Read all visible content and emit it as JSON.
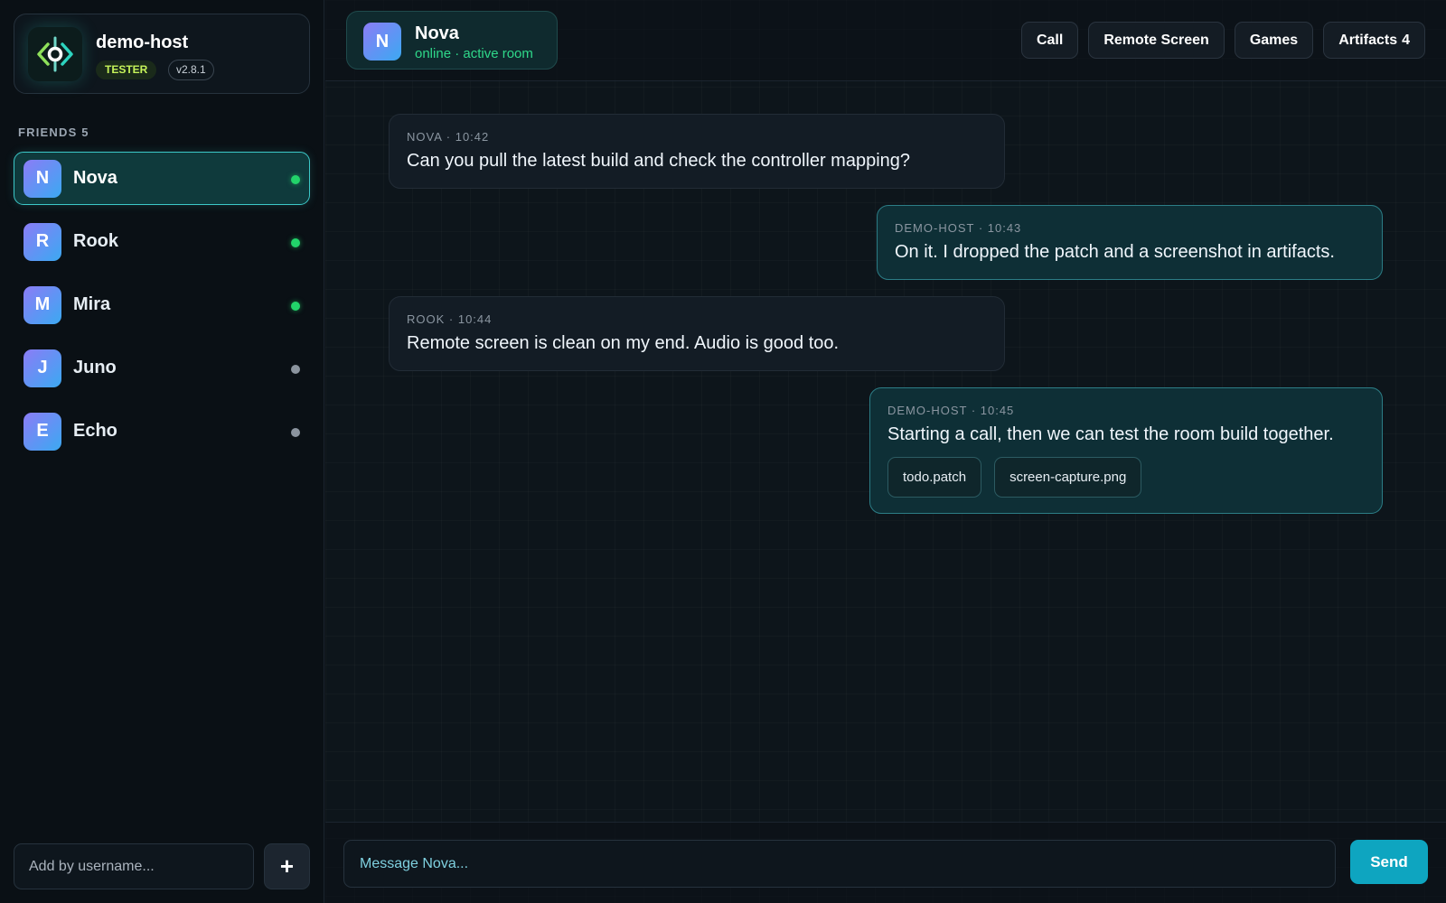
{
  "host": {
    "name": "demo-host",
    "role_badge": "TESTER",
    "version": "v2.8.1",
    "logo_icon": "code-ring-logo-icon"
  },
  "friends": {
    "header": "FRIENDS 5",
    "items": [
      {
        "initial": "N",
        "name": "Nova",
        "status": "online",
        "active": true
      },
      {
        "initial": "R",
        "name": "Rook",
        "status": "online",
        "active": false
      },
      {
        "initial": "M",
        "name": "Mira",
        "status": "online",
        "active": false
      },
      {
        "initial": "J",
        "name": "Juno",
        "status": "offline",
        "active": false
      },
      {
        "initial": "E",
        "name": "Echo",
        "status": "offline",
        "active": false
      }
    ],
    "add_placeholder": "Add by username...",
    "add_button_label": "+"
  },
  "chat": {
    "contact": {
      "initial": "N",
      "name": "Nova",
      "status": "online · active room"
    },
    "actions": {
      "call": "Call",
      "remote_screen": "Remote Screen",
      "games": "Games",
      "artifacts": "Artifacts",
      "artifacts_count": "4"
    },
    "messages": [
      {
        "meta": "NOVA · 10:42",
        "text": "Can you pull the latest build and check the controller mapping?"
      },
      {
        "meta": "DEMO-HOST · 10:43",
        "text": "On it. I dropped the patch and a screenshot in artifacts."
      },
      {
        "meta": "ROOK · 10:44",
        "text": "Remote screen is clean on my end. Audio is good too."
      },
      {
        "meta": "DEMO-HOST · 10:45",
        "text": "Starting a call, then we can test the room build together.",
        "attachments": [
          "todo.patch",
          "screen-capture.png"
        ]
      }
    ],
    "composer": {
      "placeholder": "Message Nova...",
      "send_label": "Send"
    }
  },
  "colors": {
    "accent": "#0ea5c0",
    "online": "#22d36a",
    "offline": "#8b949e",
    "avatar_gradient_start": "#8b7cf6",
    "avatar_gradient_end": "#3ba9f2"
  }
}
